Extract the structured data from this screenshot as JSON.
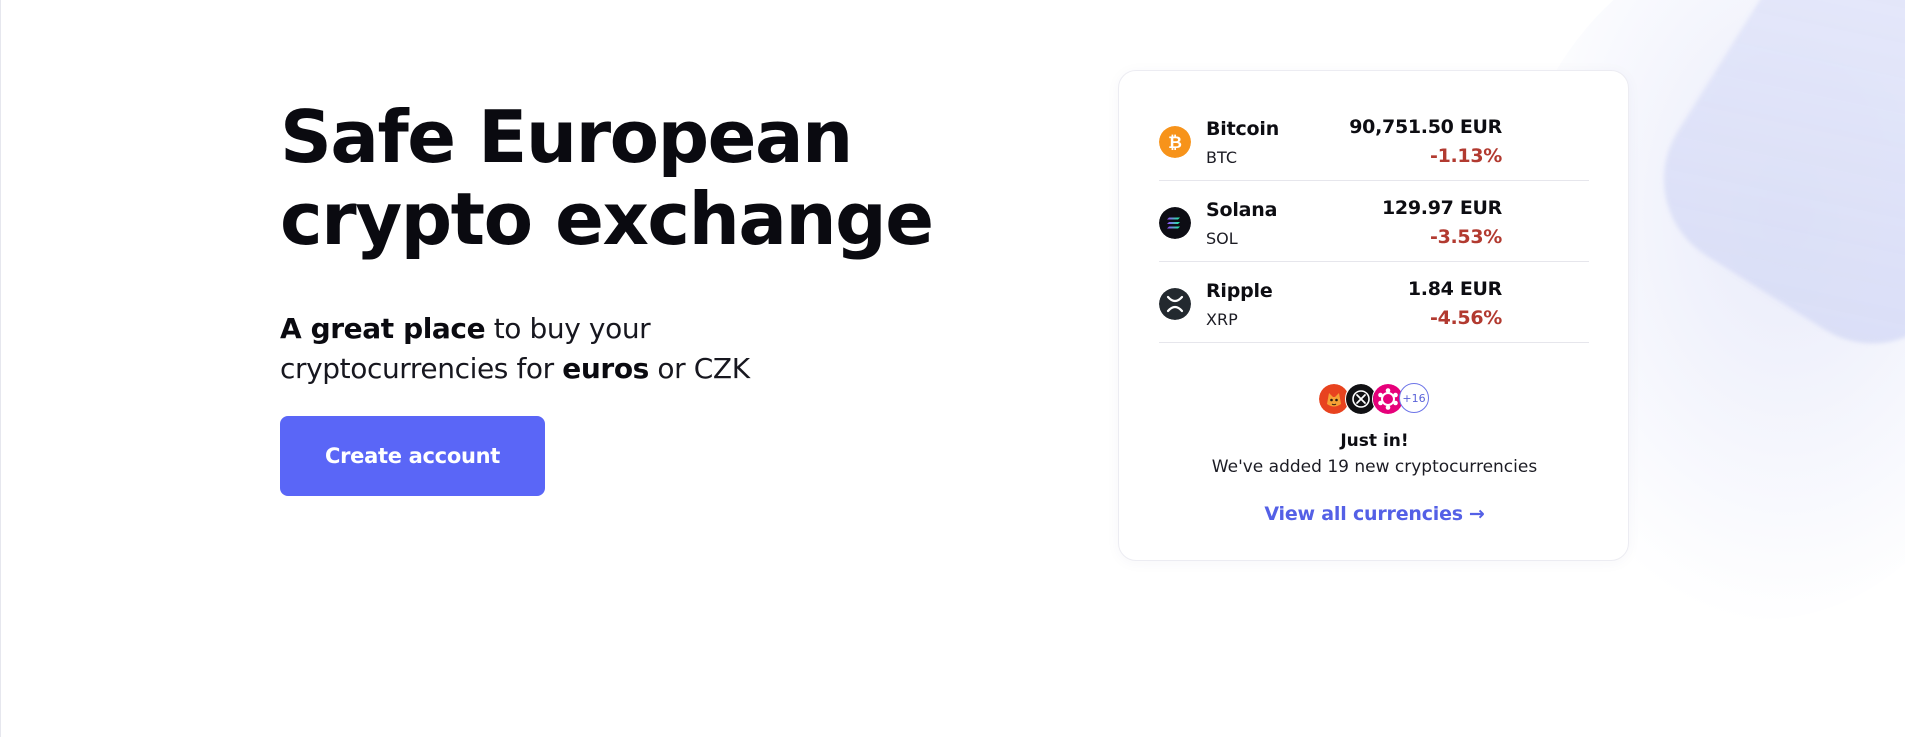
{
  "hero": {
    "title_line1": "Safe European",
    "title_line2": "crypto exchange",
    "subtitle": {
      "part1_bold": "A great place",
      "part2": " to buy your",
      "part3": "cryptocurrencies for ",
      "part4_bold": "euros",
      "part5": " or CZK"
    },
    "cta_label": "Create account"
  },
  "rates": [
    {
      "name": "Bitcoin",
      "ticker": "BTC",
      "price": "90,751.50 EUR",
      "change": "-1.13%",
      "icon": "bitcoin-icon"
    },
    {
      "name": "Solana",
      "ticker": "SOL",
      "price": "129.97 EUR",
      "change": "-3.53%",
      "icon": "solana-icon"
    },
    {
      "name": "Ripple",
      "ticker": "XRP",
      "price": "1.84 EUR",
      "change": "-4.56%",
      "icon": "ripple-icon"
    }
  ],
  "new_coins": {
    "icons": [
      "shiba-inu-icon",
      "coin-icon",
      "polkadot-icon"
    ],
    "more_count": "+16",
    "heading": "Just in!",
    "text": "We've added 19 new cryptocurrencies",
    "link_label": "View all currencies",
    "link_arrow": "→"
  },
  "colors": {
    "accent": "#5a66f7",
    "link": "#5460e6",
    "negative": "#b23a30",
    "bitcoin": "#f7931a"
  }
}
